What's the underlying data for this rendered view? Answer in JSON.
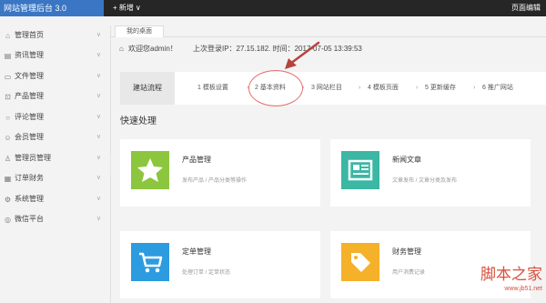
{
  "app": {
    "title": "网站管理后台 3.0",
    "new_label": "+ 新增",
    "new_chevron": "∨",
    "page_edit": "页面编辑"
  },
  "sidebar": {
    "items": [
      {
        "label": "管理首页",
        "icon": "home-icon"
      },
      {
        "label": "资讯管理",
        "icon": "news-icon"
      },
      {
        "label": "文件管理",
        "icon": "file-icon"
      },
      {
        "label": "产品管理",
        "icon": "cart-icon"
      },
      {
        "label": "评论管理",
        "icon": "comment-icon"
      },
      {
        "label": "会员管理",
        "icon": "user-icon"
      },
      {
        "label": "管理员管理",
        "icon": "admin-icon"
      },
      {
        "label": "订单财务",
        "icon": "order-icon"
      },
      {
        "label": "系统管理",
        "icon": "gear-icon"
      },
      {
        "label": "微信平台",
        "icon": "wechat-icon"
      }
    ],
    "collapse_icon": "◂"
  },
  "tabs": {
    "desktop": "我的桌面"
  },
  "infobar": {
    "welcome": "欢迎您admin！",
    "last_login": "上次登录IP：27.15.182. 时间：2017-07-05 13:39:53"
  },
  "steps": {
    "label": "建站流程",
    "items": [
      "1 模板设置",
      "2 基本资料",
      "3 网站栏目",
      "4 模板页面",
      "5 更新缓存",
      "6 推广网站"
    ],
    "separator": "›"
  },
  "quick": {
    "title": "快速处理",
    "cards": [
      {
        "title": "产品管理",
        "desc": "发布产品 / 产品分类等操作",
        "color": "#8cc63e",
        "icon": "star-icon"
      },
      {
        "title": "新闻文章",
        "desc": "文章发布 / 文章分类及发布",
        "color": "#3bb7a3",
        "icon": "newspaper-icon"
      },
      {
        "title": "定单管理",
        "desc": "处理订单 / 定单状态",
        "color": "#2d9be0",
        "icon": "cart-icon"
      },
      {
        "title": "财务管理",
        "desc": "用户消费记录",
        "color": "#f5b12a",
        "icon": "tag-icon"
      }
    ]
  },
  "watermark": {
    "title": "脚本之家",
    "url": "www.jb51.net"
  },
  "colors": {
    "topbar": "#262626",
    "brand": "#3a76c4",
    "annotation": "#b5443c"
  }
}
